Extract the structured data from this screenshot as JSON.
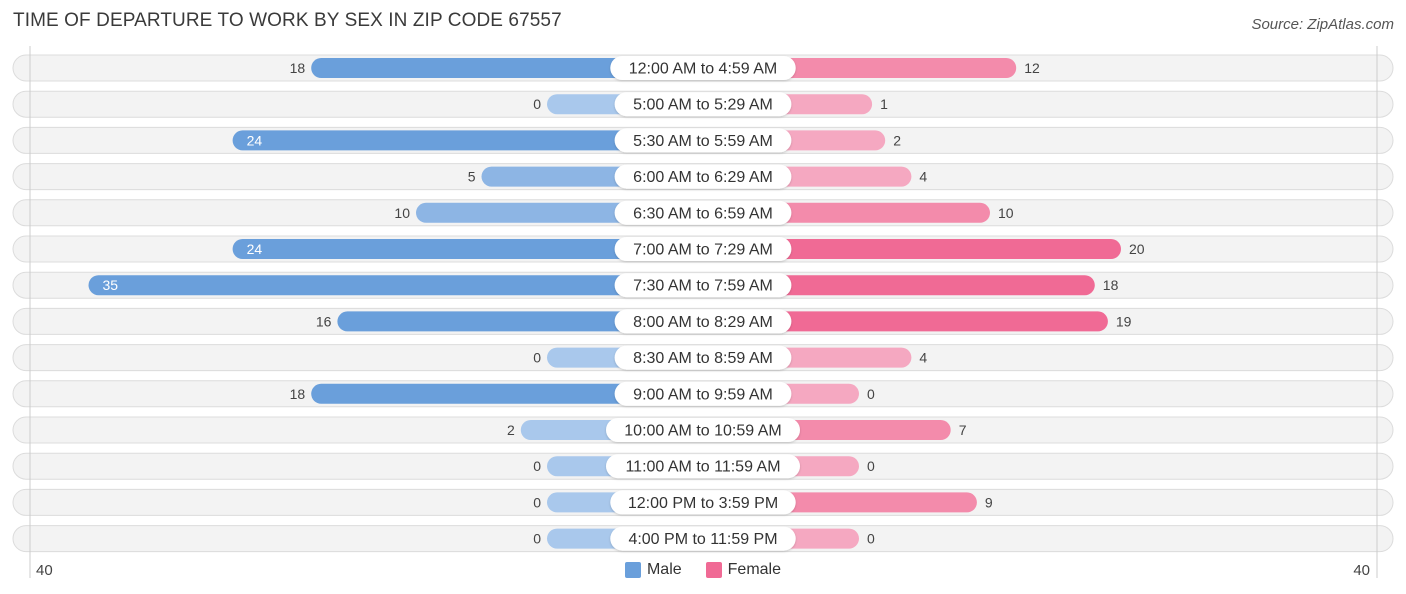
{
  "title": "TIME OF DEPARTURE TO WORK BY SEX IN ZIP CODE 67557",
  "source": "Source: ZipAtlas.com",
  "colors": {
    "male_strong": "#6a9fdb",
    "male_light": "#a9c8ec",
    "female_strong": "#f06a95",
    "female_light": "#f5a8c1",
    "row_bg": "#f3f3f3",
    "row_border": "#dcdcdc"
  },
  "legend": [
    {
      "label": "Male",
      "color": "#6a9fdb"
    },
    {
      "label": "Female",
      "color": "#f06a95"
    }
  ],
  "axis": {
    "left_label": "40",
    "right_label": "40"
  },
  "chart_data": {
    "type": "bar",
    "orientation": "horizontal-diverging",
    "title": "TIME OF DEPARTURE TO WORK BY SEX IN ZIP CODE 67557",
    "xlabel": "",
    "ylabel": "",
    "xlim": [
      -40,
      40
    ],
    "grid": false,
    "legend_position": "bottom-center",
    "categories": [
      "12:00 AM to 4:59 AM",
      "5:00 AM to 5:29 AM",
      "5:30 AM to 5:59 AM",
      "6:00 AM to 6:29 AM",
      "6:30 AM to 6:59 AM",
      "7:00 AM to 7:29 AM",
      "7:30 AM to 7:59 AM",
      "8:00 AM to 8:29 AM",
      "8:30 AM to 8:59 AM",
      "9:00 AM to 9:59 AM",
      "10:00 AM to 10:59 AM",
      "11:00 AM to 11:59 AM",
      "12:00 PM to 3:59 PM",
      "4:00 PM to 11:59 PM"
    ],
    "series": [
      {
        "name": "Male",
        "values": [
          18,
          0,
          24,
          5,
          10,
          24,
          35,
          16,
          0,
          18,
          2,
          0,
          0,
          0
        ]
      },
      {
        "name": "Female",
        "values": [
          12,
          1,
          2,
          4,
          10,
          20,
          18,
          19,
          4,
          0,
          7,
          0,
          9,
          0
        ]
      }
    ]
  }
}
